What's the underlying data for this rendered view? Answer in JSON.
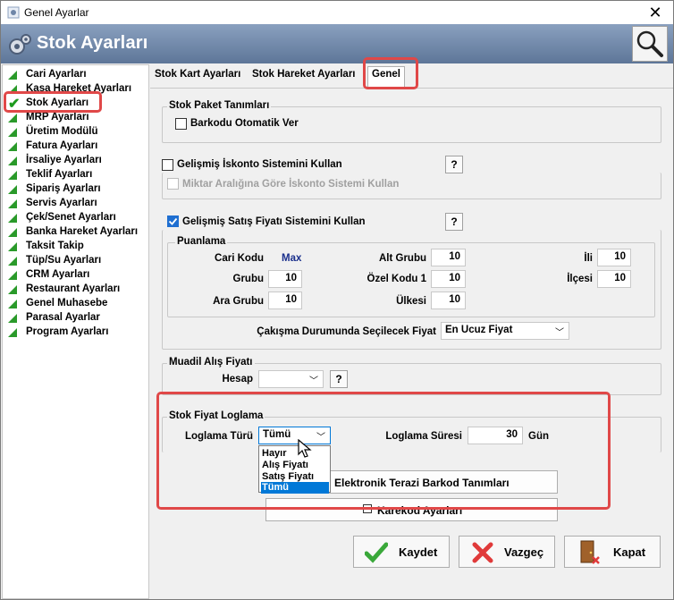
{
  "window": {
    "title": "Genel Ayarlar",
    "close_glyph": "✕"
  },
  "banner": {
    "title": "Stok Ayarları"
  },
  "sidebar": {
    "items": [
      {
        "label": "Cari Ayarları"
      },
      {
        "label": "Kasa Hareket Ayarları"
      },
      {
        "label": "Stok Ayarları",
        "selected": true
      },
      {
        "label": "MRP Ayarları"
      },
      {
        "label": "Üretim Modülü"
      },
      {
        "label": "Fatura Ayarları"
      },
      {
        "label": "İrsaliye Ayarları"
      },
      {
        "label": "Teklif Ayarları"
      },
      {
        "label": "Sipariş Ayarları"
      },
      {
        "label": "Servis Ayarları"
      },
      {
        "label": "Çek/Senet Ayarları"
      },
      {
        "label": "Banka Hareket Ayarları"
      },
      {
        "label": "Taksit Takip"
      },
      {
        "label": "Tüp/Su Ayarları"
      },
      {
        "label": "CRM Ayarları"
      },
      {
        "label": "Restaurant Ayarları"
      },
      {
        "label": "Genel Muhasebe"
      },
      {
        "label": "Parasal Ayarlar"
      },
      {
        "label": "Program Ayarları"
      }
    ]
  },
  "tabs": [
    {
      "label": "Stok Kart Ayarları"
    },
    {
      "label": "Stok Hareket Ayarları"
    },
    {
      "label": "Genel",
      "active": true
    }
  ],
  "stok_paket": {
    "title": "Stok Paket Tanımları",
    "barkodu_otomatik": "Barkodu Otomatik Ver"
  },
  "iskonto": {
    "label": "Gelişmiş İskonto Sistemini Kullan",
    "sub_label": "Miktar Aralığına Göre İskonto Sistemi Kullan",
    "help": "?"
  },
  "satis_fiyati": {
    "label": "Gelişmiş Satış Fiyatı Sistemini Kullan",
    "help": "?",
    "puanlama_title": "Puanlama",
    "cari_kodu_label": "Cari Kodu",
    "cari_kodu_value": "Max",
    "grubu_label": "Grubu",
    "grubu_value": "10",
    "ara_grubu_label": "Ara Grubu",
    "ara_grubu_value": "10",
    "alt_grubu_label": "Alt Grubu",
    "alt_grubu_value": "10",
    "ozel_kodu_label": "Özel Kodu 1",
    "ozel_kodu_value": "10",
    "ulkesi_label": "Ülkesi",
    "ulkesi_value": "10",
    "ili_label": "İli",
    "ili_value": "10",
    "ilcesi_label": "İlçesi",
    "ilcesi_value": "10",
    "cakisma_label": "Çakışma Durumunda Seçilecek Fiyat",
    "cakisma_value": "En Ucuz Fiyat"
  },
  "muadil": {
    "title": "Muadil Alış Fiyatı",
    "hesap_label": "Hesap",
    "hesap_value": "",
    "help": "?"
  },
  "loglama": {
    "title": "Stok Fiyat Loglama",
    "turu_label": "Loglama Türü",
    "turu_value": "Tümü",
    "suresi_label": "Loglama Süresi",
    "suresi_value": "30",
    "suresi_unit": "Gün",
    "options": [
      "Hayır",
      "Alış Fiyatı",
      "Satış Fiyatı",
      "Tümü"
    ],
    "highlighted_option": "Tümü"
  },
  "buttons": {
    "terazi": "Elektronik Terazi Barkod Tanımları",
    "karekod": "Karekod Ayarları",
    "kaydet": "Kaydet",
    "vazgec": "Vazgeç",
    "kapat": "Kapat"
  },
  "colors": {
    "accent_red": "#e04848",
    "banner": "#6f86a8",
    "selection": "#0078d7",
    "check_green": "#1d9a1d"
  }
}
